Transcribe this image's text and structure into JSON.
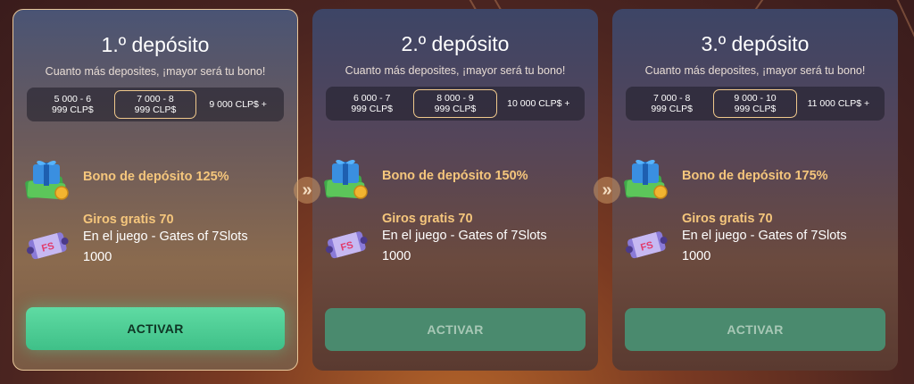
{
  "subtitle": "Cuanto más deposites, ¡mayor será tu bono!",
  "activate_label": "ACTIVAR",
  "colors": {
    "accent_gold": "#f5c67c",
    "activate_active": "#4fcf94",
    "activate_inactive": "#4a8a6e"
  },
  "icons": {
    "bonus": "gift-cash-icon",
    "spins": "fs-ticket-icon",
    "arrow": "double-chevron-right-icon"
  },
  "cards": [
    {
      "title": "1.º depósito",
      "tiers": [
        {
          "line1": "5 000 - 6",
          "line2": "999 CLP$"
        },
        {
          "line1": "7 000 - 8",
          "line2": "999 CLP$"
        },
        {
          "line1": "9 000 CLP$ +",
          "line2": ""
        }
      ],
      "bonus": "Bono de depósito 125%",
      "spins_title": "Giros gratis 70",
      "spins_game": "En el juego - Gates of 7Slots",
      "spins_amount": "1000"
    },
    {
      "title": "2.º depósito",
      "tiers": [
        {
          "line1": "6 000 - 7",
          "line2": "999 CLP$"
        },
        {
          "line1": "8 000 - 9",
          "line2": "999 CLP$"
        },
        {
          "line1": "10 000 CLP$ +",
          "line2": ""
        }
      ],
      "bonus": "Bono de depósito 150%",
      "spins_title": "Giros gratis 70",
      "spins_game": "En el juego - Gates of 7Slots",
      "spins_amount": "1000"
    },
    {
      "title": "3.º depósito",
      "tiers": [
        {
          "line1": "7 000 - 8",
          "line2": "999 CLP$"
        },
        {
          "line1": "9 000 - 10",
          "line2": "999 CLP$"
        },
        {
          "line1": "11 000 CLP$ +",
          "line2": ""
        }
      ],
      "bonus": "Bono de depósito 175%",
      "spins_title": "Giros gratis 70",
      "spins_game": "En el juego - Gates of 7Slots",
      "spins_amount": "1000"
    }
  ],
  "arrow_glyph": "»"
}
